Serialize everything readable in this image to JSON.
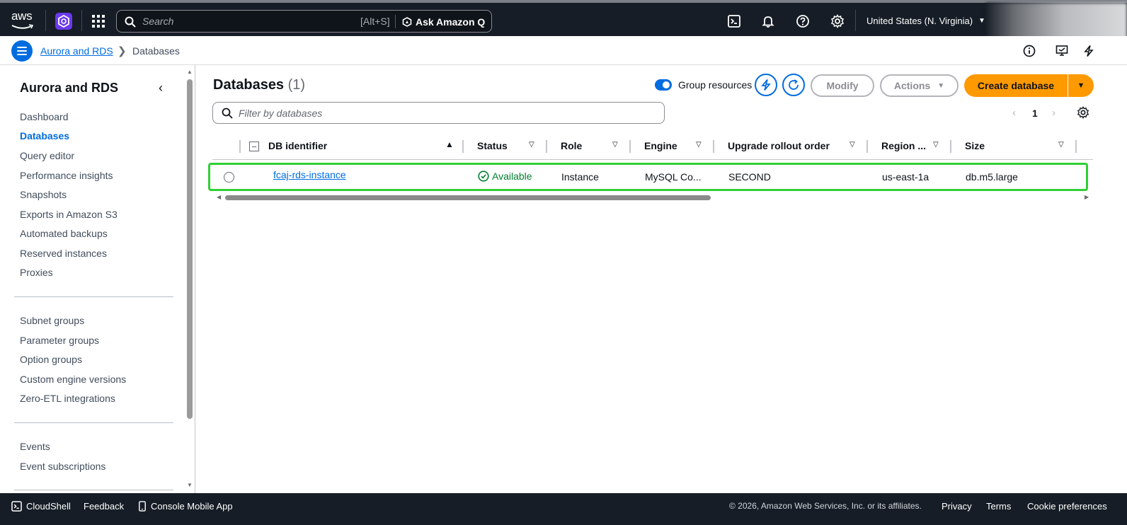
{
  "topnav": {
    "logo_text": "aws",
    "search_placeholder": "Search",
    "search_shortcut": "[Alt+S]",
    "ask_q_label": "Ask Amazon Q",
    "region": "United States (N. Virginia)"
  },
  "breadcrumb": {
    "parent": "Aurora and RDS",
    "current": "Databases"
  },
  "sidebar": {
    "title": "Aurora and RDS",
    "group1": [
      "Dashboard",
      "Databases",
      "Query editor",
      "Performance insights",
      "Snapshots",
      "Exports in Amazon S3",
      "Automated backups",
      "Reserved instances",
      "Proxies"
    ],
    "group2": [
      "Subnet groups",
      "Parameter groups",
      "Option groups",
      "Custom engine versions",
      "Zero-ETL integrations"
    ],
    "group3": [
      "Events",
      "Event subscriptions"
    ],
    "active": "Databases"
  },
  "main": {
    "title": "Databases",
    "count": "(1)",
    "group_resources_label": "Group resources",
    "group_resources_on": true,
    "modify_label": "Modify",
    "actions_label": "Actions",
    "create_label": "Create database",
    "filter_placeholder": "Filter by databases",
    "page": "1"
  },
  "table": {
    "columns": [
      "DB identifier",
      "Status",
      "Role",
      "Engine",
      "Upgrade rollout order",
      "Region ...",
      "Size"
    ],
    "rows": [
      {
        "identifier": "fcaj-rds-instance",
        "status": "Available",
        "role": "Instance",
        "engine": "MySQL Co...",
        "rollout": "SECOND",
        "region": "us-east-1a",
        "size": "db.m5.large"
      }
    ]
  },
  "footer": {
    "cloudshell": "CloudShell",
    "feedback": "Feedback",
    "mobile": "Console Mobile App",
    "copyright": "© 2026, Amazon Web Services, Inc. or its affiliates.",
    "privacy": "Privacy",
    "terms": "Terms",
    "cookies": "Cookie preferences"
  },
  "colors": {
    "nav_bg": "#161d26",
    "link": "#006ce0",
    "primary_button": "#ff9900",
    "status_ok": "#00802f",
    "row_highlight": "#2fd033"
  }
}
